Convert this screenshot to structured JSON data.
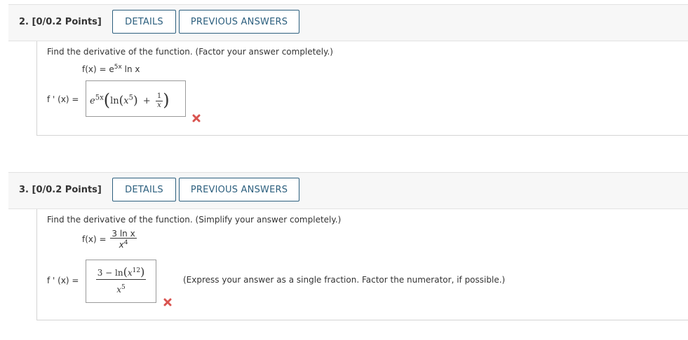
{
  "questions": [
    {
      "title": "2. [0/0.2 Points]",
      "details_label": "DETAILS",
      "previous_answers_label": "PREVIOUS ANSWERS",
      "prompt": "Find the derivative of the function. (Factor your answer completely.)",
      "function_lhs": "f(x) = e",
      "function_exp": "5x",
      "function_rest": " ln x",
      "answer_label": "f ' (x) =",
      "answer": {
        "base": "e",
        "exp": "5x",
        "ln": "ln",
        "x": "x",
        "x_exp": "5",
        "plus": "+",
        "num": "1",
        "den": "x"
      },
      "status": "incorrect"
    },
    {
      "title": "3. [0/0.2 Points]",
      "details_label": "DETAILS",
      "previous_answers_label": "PREVIOUS ANSWERS",
      "prompt": "Find the derivative of the function. (Simplify your answer completely.)",
      "function_lhs": "f(x) =",
      "function_num": "3 ln x",
      "function_den_base": "x",
      "function_den_exp": "4",
      "answer_label": "f ' (x) =",
      "answer": {
        "num_const": "3 − ln",
        "x": "x",
        "x_exp": "12",
        "den_base": "x",
        "den_exp": "5"
      },
      "note": "(Express your answer as a single fraction. Factor the numerator, if possible.)",
      "status": "incorrect"
    }
  ],
  "colors": {
    "button_border": "#2c5f7e",
    "incorrect": "#d9534f",
    "header_bg": "#f7f7f7"
  }
}
